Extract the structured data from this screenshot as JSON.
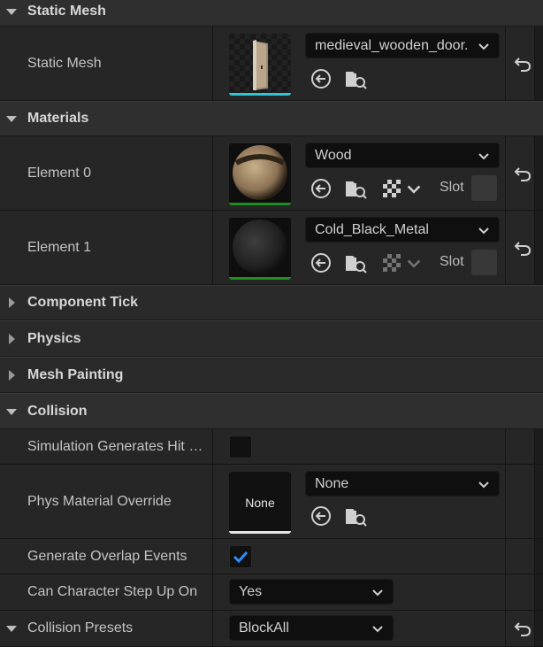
{
  "sections": {
    "static_mesh": "Static Mesh",
    "materials": "Materials",
    "component_tick": "Component Tick",
    "physics": "Physics",
    "mesh_painting": "Mesh Painting",
    "collision": "Collision"
  },
  "static_mesh": {
    "label": "Static Mesh",
    "value": "medieval_wooden_door."
  },
  "materials": {
    "element0": {
      "label": "Element 0",
      "value": "Wood",
      "slot_label": "Slot"
    },
    "element1": {
      "label": "Element 1",
      "value": "Cold_Black_Metal",
      "slot_label": "Slot"
    }
  },
  "collision": {
    "sim_hit": {
      "label": "Simulation Generates Hit Events",
      "checked": false
    },
    "phys_material": {
      "label": "Phys Material Override",
      "thumb_text": "None",
      "value": "None"
    },
    "overlap": {
      "label": "Generate Overlap Events",
      "checked": true
    },
    "step_up": {
      "label": "Can Character Step Up On",
      "value": "Yes"
    },
    "presets": {
      "label": "Collision Presets",
      "value": "BlockAll"
    }
  },
  "colors": {
    "mesh_accent": "#2fc7d6",
    "material_accent": "#1e8f1e",
    "checkbox_check": "#2f8cff"
  }
}
